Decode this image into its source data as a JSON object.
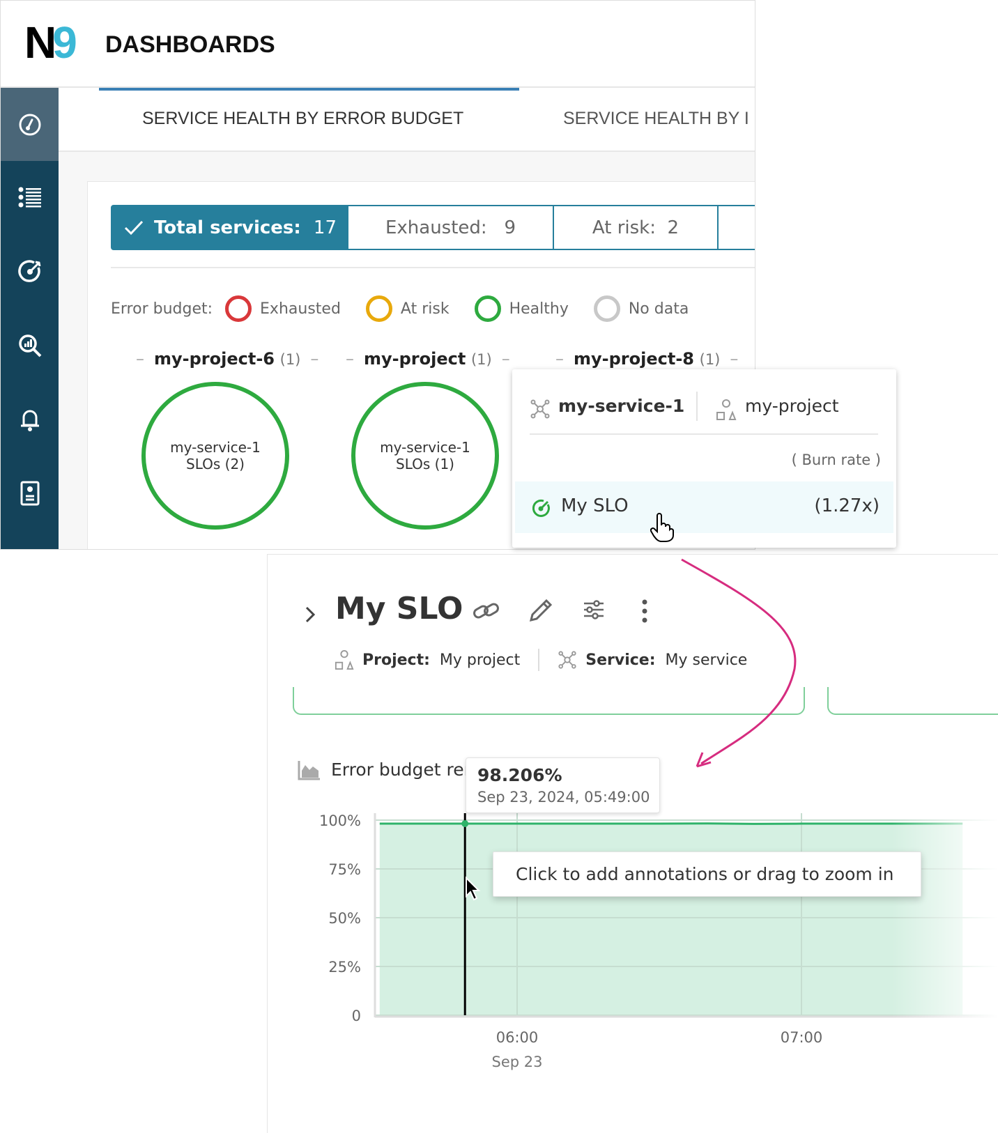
{
  "app": {
    "logo": "N9",
    "title": "DASHBOARDS"
  },
  "sidebar": {
    "items": [
      {
        "icon": "speedometer-icon",
        "active": true
      },
      {
        "icon": "list-icon"
      },
      {
        "icon": "slo-target-icon"
      },
      {
        "icon": "analytics-search-icon"
      },
      {
        "icon": "bell-icon"
      },
      {
        "icon": "report-icon"
      }
    ]
  },
  "tabs": [
    {
      "label": "SERVICE HEALTH BY ERROR BUDGET",
      "active": true
    },
    {
      "label": "SERVICE HEALTH BY I"
    }
  ],
  "stats": {
    "total_label": "Total services:",
    "total_value": "17",
    "exhausted_label": "Exhausted:",
    "exhausted_value": "9",
    "atrisk_label": "At risk:",
    "atrisk_value": "2"
  },
  "legend": {
    "label": "Error budget:",
    "items": [
      {
        "label": "Exhausted",
        "color": "#d9383a"
      },
      {
        "label": "At risk",
        "color": "#e8a90c"
      },
      {
        "label": "Healthy",
        "color": "#2eaa3f"
      },
      {
        "label": "No data",
        "color": "#c8c8c8"
      }
    ]
  },
  "projects": [
    {
      "name": "my-project-6",
      "count": "(1)",
      "service": "my-service-1",
      "slos": "SLOs (2)"
    },
    {
      "name": "my-project",
      "count": "(1)",
      "service": "my-service-1",
      "slos": "SLOs (1)"
    },
    {
      "name": "my-project-8",
      "count": "(1)"
    }
  ],
  "popup": {
    "service": "my-service-1",
    "project": "my-project",
    "column": "( Burn rate )",
    "slo_name": "My SLO",
    "burn_rate": "(1.27x)"
  },
  "slo": {
    "title": "My SLO",
    "project_label": "Project:",
    "project_value": "My project",
    "service_label": "Service:",
    "service_value": "My service"
  },
  "chart_section": {
    "title": "Error budget rer",
    "tooltip_value": "98.206%",
    "tooltip_time": "Sep 23, 2024, 05:49:00",
    "hint": "Click to add annotations or drag to zoom in"
  },
  "colors": {
    "accent": "#267f9c",
    "sidebar": "#14435a",
    "healthy": "#2eaa3f",
    "arrow": "#d62c7f",
    "area": "#d5f0e2",
    "line": "#2fb36a"
  },
  "chart_data": {
    "type": "area",
    "yticks": [
      "100%",
      "75%",
      "50%",
      "25%",
      "0"
    ],
    "ylim": [
      0,
      100
    ],
    "xticks": [
      {
        "label": "06:00",
        "sub": "Sep 23"
      },
      {
        "label": "07:00",
        "sub": ""
      }
    ],
    "x": [
      "05:31",
      "05:49",
      "06:30",
      "06:40",
      "06:50",
      "07:00",
      "07:34"
    ],
    "values": [
      98.2,
      98.206,
      98.2,
      98.3,
      98.1,
      98.2,
      98.2
    ],
    "cursor": "05:49",
    "grid": true
  }
}
